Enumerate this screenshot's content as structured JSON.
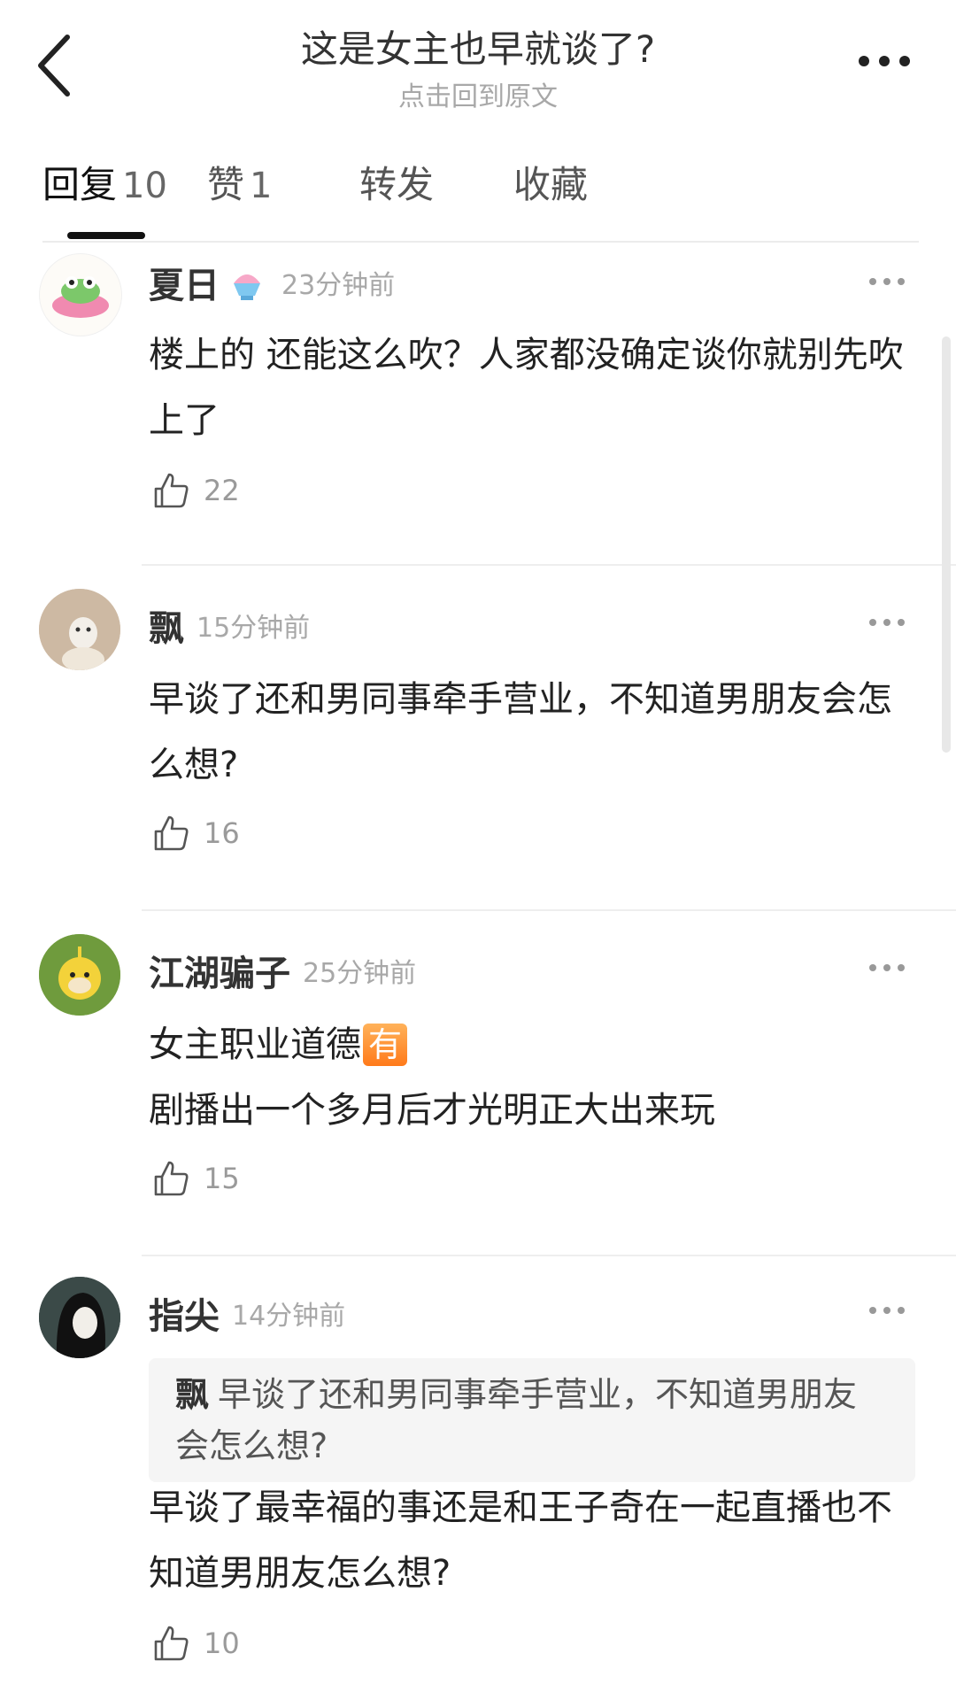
{
  "header": {
    "title": "这是女主也早就谈了?",
    "subtitle": "点击回到原文"
  },
  "tabs": [
    {
      "label": "回复",
      "count": "10",
      "active": true
    },
    {
      "label": "赞",
      "count": "1"
    },
    {
      "label": "转发",
      "count": ""
    },
    {
      "label": "收藏",
      "count": ""
    }
  ],
  "comments": [
    {
      "username": "夏日",
      "has_name_emoji": true,
      "time": "23分钟前",
      "text": "楼上的 还能这么吹？人家都没确定谈你就别先吹上了",
      "likes": "22"
    },
    {
      "username": "飘",
      "time": "15分钟前",
      "text": "早谈了还和男同事牵手营业，不知道男朋友会怎么想?",
      "likes": "16"
    },
    {
      "username": "江湖骗子",
      "time": "25分钟前",
      "text_line1": "女主职业道德",
      "badge": "有",
      "text_line2": "剧播出一个多月后才光明正大出来玩",
      "likes": "15"
    },
    {
      "username": "指尖",
      "time": "14分钟前",
      "quote_name": "飘",
      "quote_text": "早谈了还和男同事牵手营业，不知道男朋友会怎么想?",
      "text": "早谈了最幸福的事还是和王子奇在一起直播也不知道男朋友怎么想?",
      "likes": "10"
    }
  ],
  "icons": {
    "back": "chevron-left-icon",
    "more": "more-dots-icon",
    "like": "thumbs-up-icon"
  }
}
